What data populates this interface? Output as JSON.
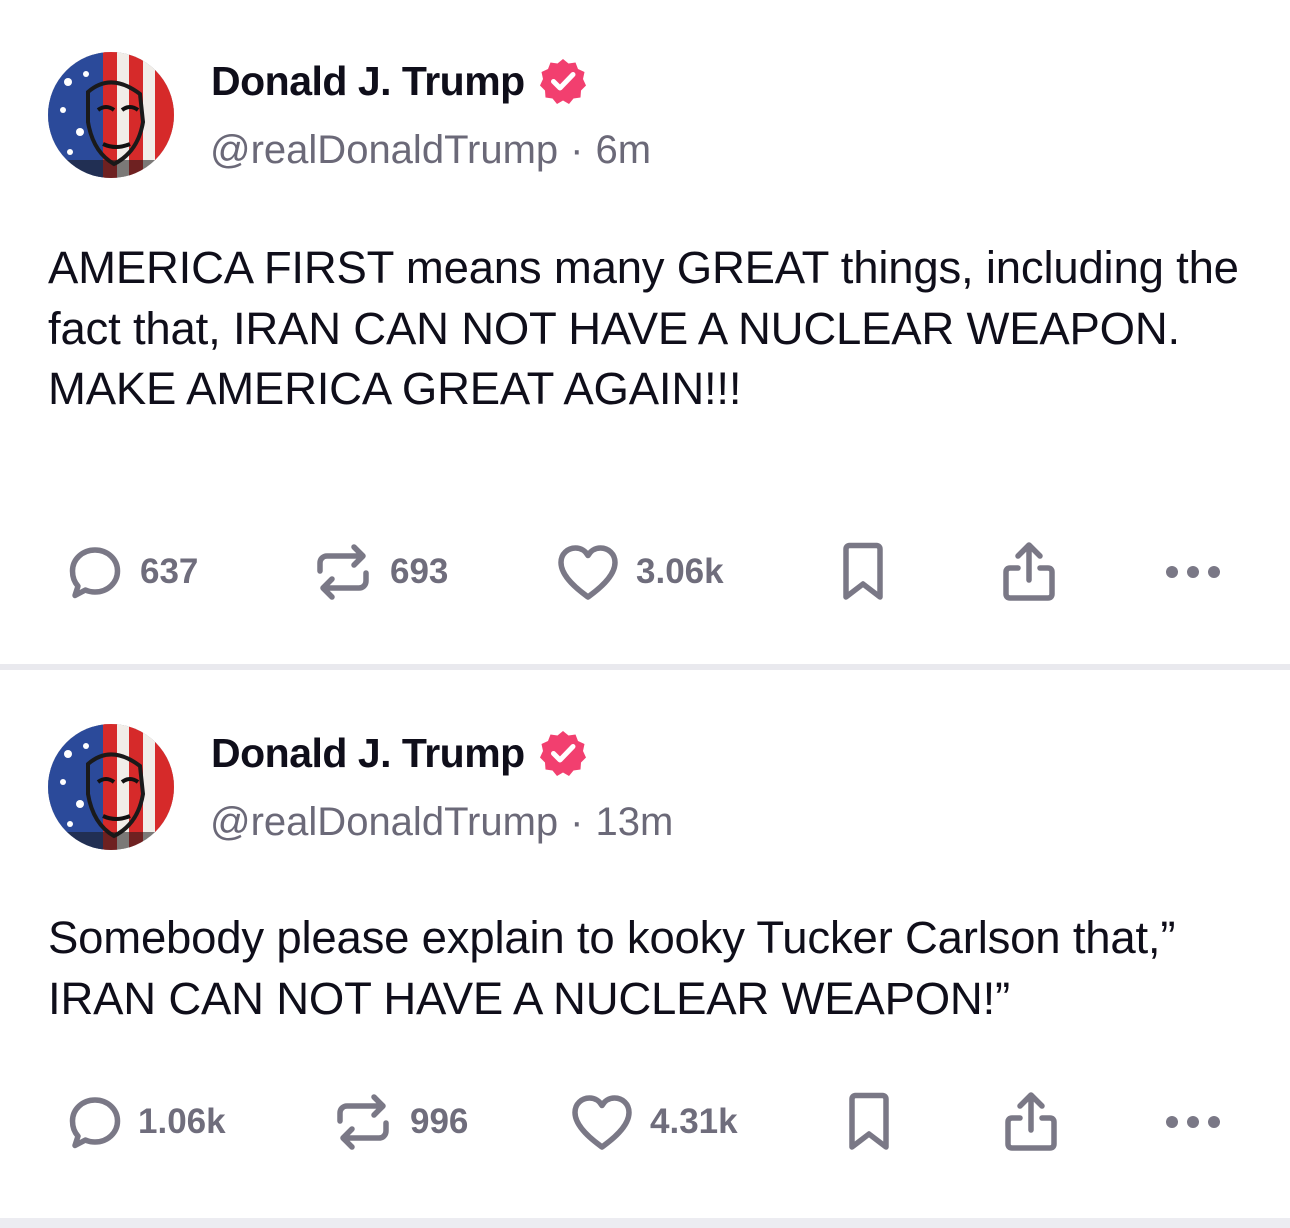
{
  "posts": [
    {
      "author": {
        "name": "Donald J. Trump",
        "handle": "@realDonaldTrump",
        "verified": true
      },
      "time": "6m",
      "text": "AMERICA FIRST means many GREAT things, including the fact that, IRAN CAN NOT HAVE A NUCLEAR WEAPON. MAKE AMERICA GREAT AGAIN!!!",
      "stats": {
        "replies": "637",
        "reposts": "693",
        "likes": "3.06k"
      }
    },
    {
      "author": {
        "name": "Donald J. Trump",
        "handle": "@realDonaldTrump",
        "verified": true
      },
      "time": "13m",
      "text": "Somebody please explain to kooky Tucker Carlson that,” IRAN CAN NOT HAVE A NUCLEAR WEAPON!”",
      "stats": {
        "replies": "1.06k",
        "reposts": "996",
        "likes": "4.31k"
      }
    }
  ],
  "icons": {
    "reply": "reply-icon",
    "repost": "repost-icon",
    "like": "heart-icon",
    "bookmark": "bookmark-icon",
    "share": "share-icon",
    "more": "more-icon",
    "verified": "verified-badge-icon"
  },
  "colors": {
    "verified_badge": "#f23f6f",
    "icon_gray": "#7a7886",
    "text": "#0f0e1a",
    "muted": "#6b6978"
  }
}
